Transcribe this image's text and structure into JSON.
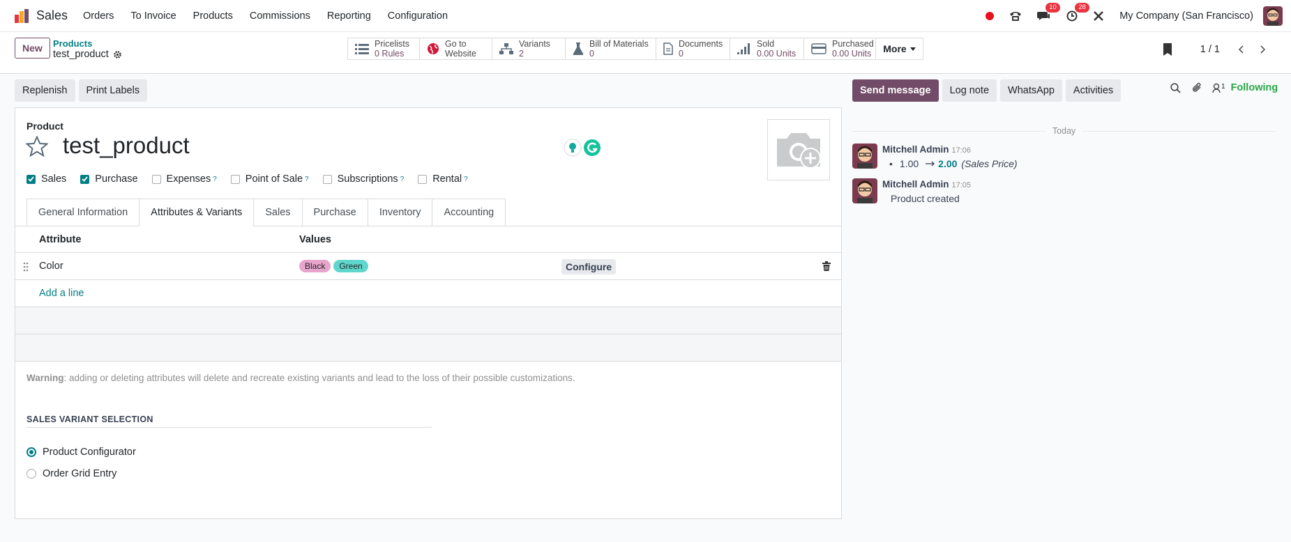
{
  "topnav": {
    "app_name": "Sales",
    "menu": [
      "Orders",
      "To Invoice",
      "Products",
      "Commissions",
      "Reporting",
      "Configuration"
    ],
    "messages_badge": "10",
    "activities_badge": "28",
    "company": "My Company (San Francisco)"
  },
  "control": {
    "new_label": "New",
    "breadcrumb_parent": "Products",
    "breadcrumb_current": "test_product",
    "smart_buttons": [
      {
        "label": "Pricelists",
        "value": "0 Rules",
        "icon": "list-icon"
      },
      {
        "label": "Go to",
        "value": "Website",
        "icon": "globe-icon"
      },
      {
        "label": "Variants",
        "value": "2",
        "icon": "sitemap-icon"
      },
      {
        "label": "Bill of Materials",
        "value": "0",
        "icon": "flask-icon"
      },
      {
        "label": "Documents",
        "value": "0",
        "icon": "document-icon"
      },
      {
        "label": "Sold",
        "value": "0.00 Units",
        "icon": "signal-icon"
      },
      {
        "label": "Purchased",
        "value": "0.00 Units",
        "icon": "credit-card-icon"
      }
    ],
    "more_label": "More",
    "pager": "1 / 1"
  },
  "actions": {
    "replenish": "Replenish",
    "print_labels": "Print Labels"
  },
  "form": {
    "product_label": "Product",
    "product_name": "test_product",
    "checkboxes": [
      {
        "label": "Sales",
        "checked": true,
        "help": ""
      },
      {
        "label": "Purchase",
        "checked": true,
        "help": ""
      },
      {
        "label": "Expenses",
        "checked": false,
        "help": "?"
      },
      {
        "label": "Point of Sale",
        "checked": false,
        "help": "?"
      },
      {
        "label": "Subscriptions",
        "checked": false,
        "help": "?"
      },
      {
        "label": "Rental",
        "checked": false,
        "help": "?"
      }
    ],
    "tabs": [
      "General Information",
      "Attributes & Variants",
      "Sales",
      "Purchase",
      "Inventory",
      "Accounting"
    ],
    "active_tab": "Attributes & Variants",
    "table": {
      "headers": [
        "Attribute",
        "Values"
      ],
      "rows": [
        {
          "attribute": "Color",
          "values": [
            {
              "label": "Black",
              "color": "#e8a5cc"
            },
            {
              "label": "Green",
              "color": "#5fd7cc"
            }
          ],
          "configure": "Configure"
        }
      ],
      "add_line": "Add a line"
    },
    "warning_bold": "Warning",
    "warning_text": ": adding or deleting attributes will delete and recreate existing variants and lead to the loss of their possible customizations.",
    "section_title": "SALES VARIANT SELECTION",
    "radio_options": [
      {
        "label": "Product Configurator",
        "selected": true
      },
      {
        "label": "Order Grid Entry",
        "selected": false
      }
    ]
  },
  "chatter": {
    "send_message": "Send message",
    "log_note": "Log note",
    "whatsapp": "WhatsApp",
    "activities": "Activities",
    "followers_count": "1",
    "following": "Following",
    "today": "Today",
    "messages": [
      {
        "author": "Mitchell Admin",
        "time": "17:06",
        "old": "1.00",
        "new": "2.00",
        "field": "(Sales Price)"
      },
      {
        "author": "Mitchell Admin",
        "time": "17:05",
        "body": "Product created"
      }
    ]
  },
  "colors": {
    "primary": "#714b67",
    "teal": "#017e84",
    "following": "#28a745"
  }
}
